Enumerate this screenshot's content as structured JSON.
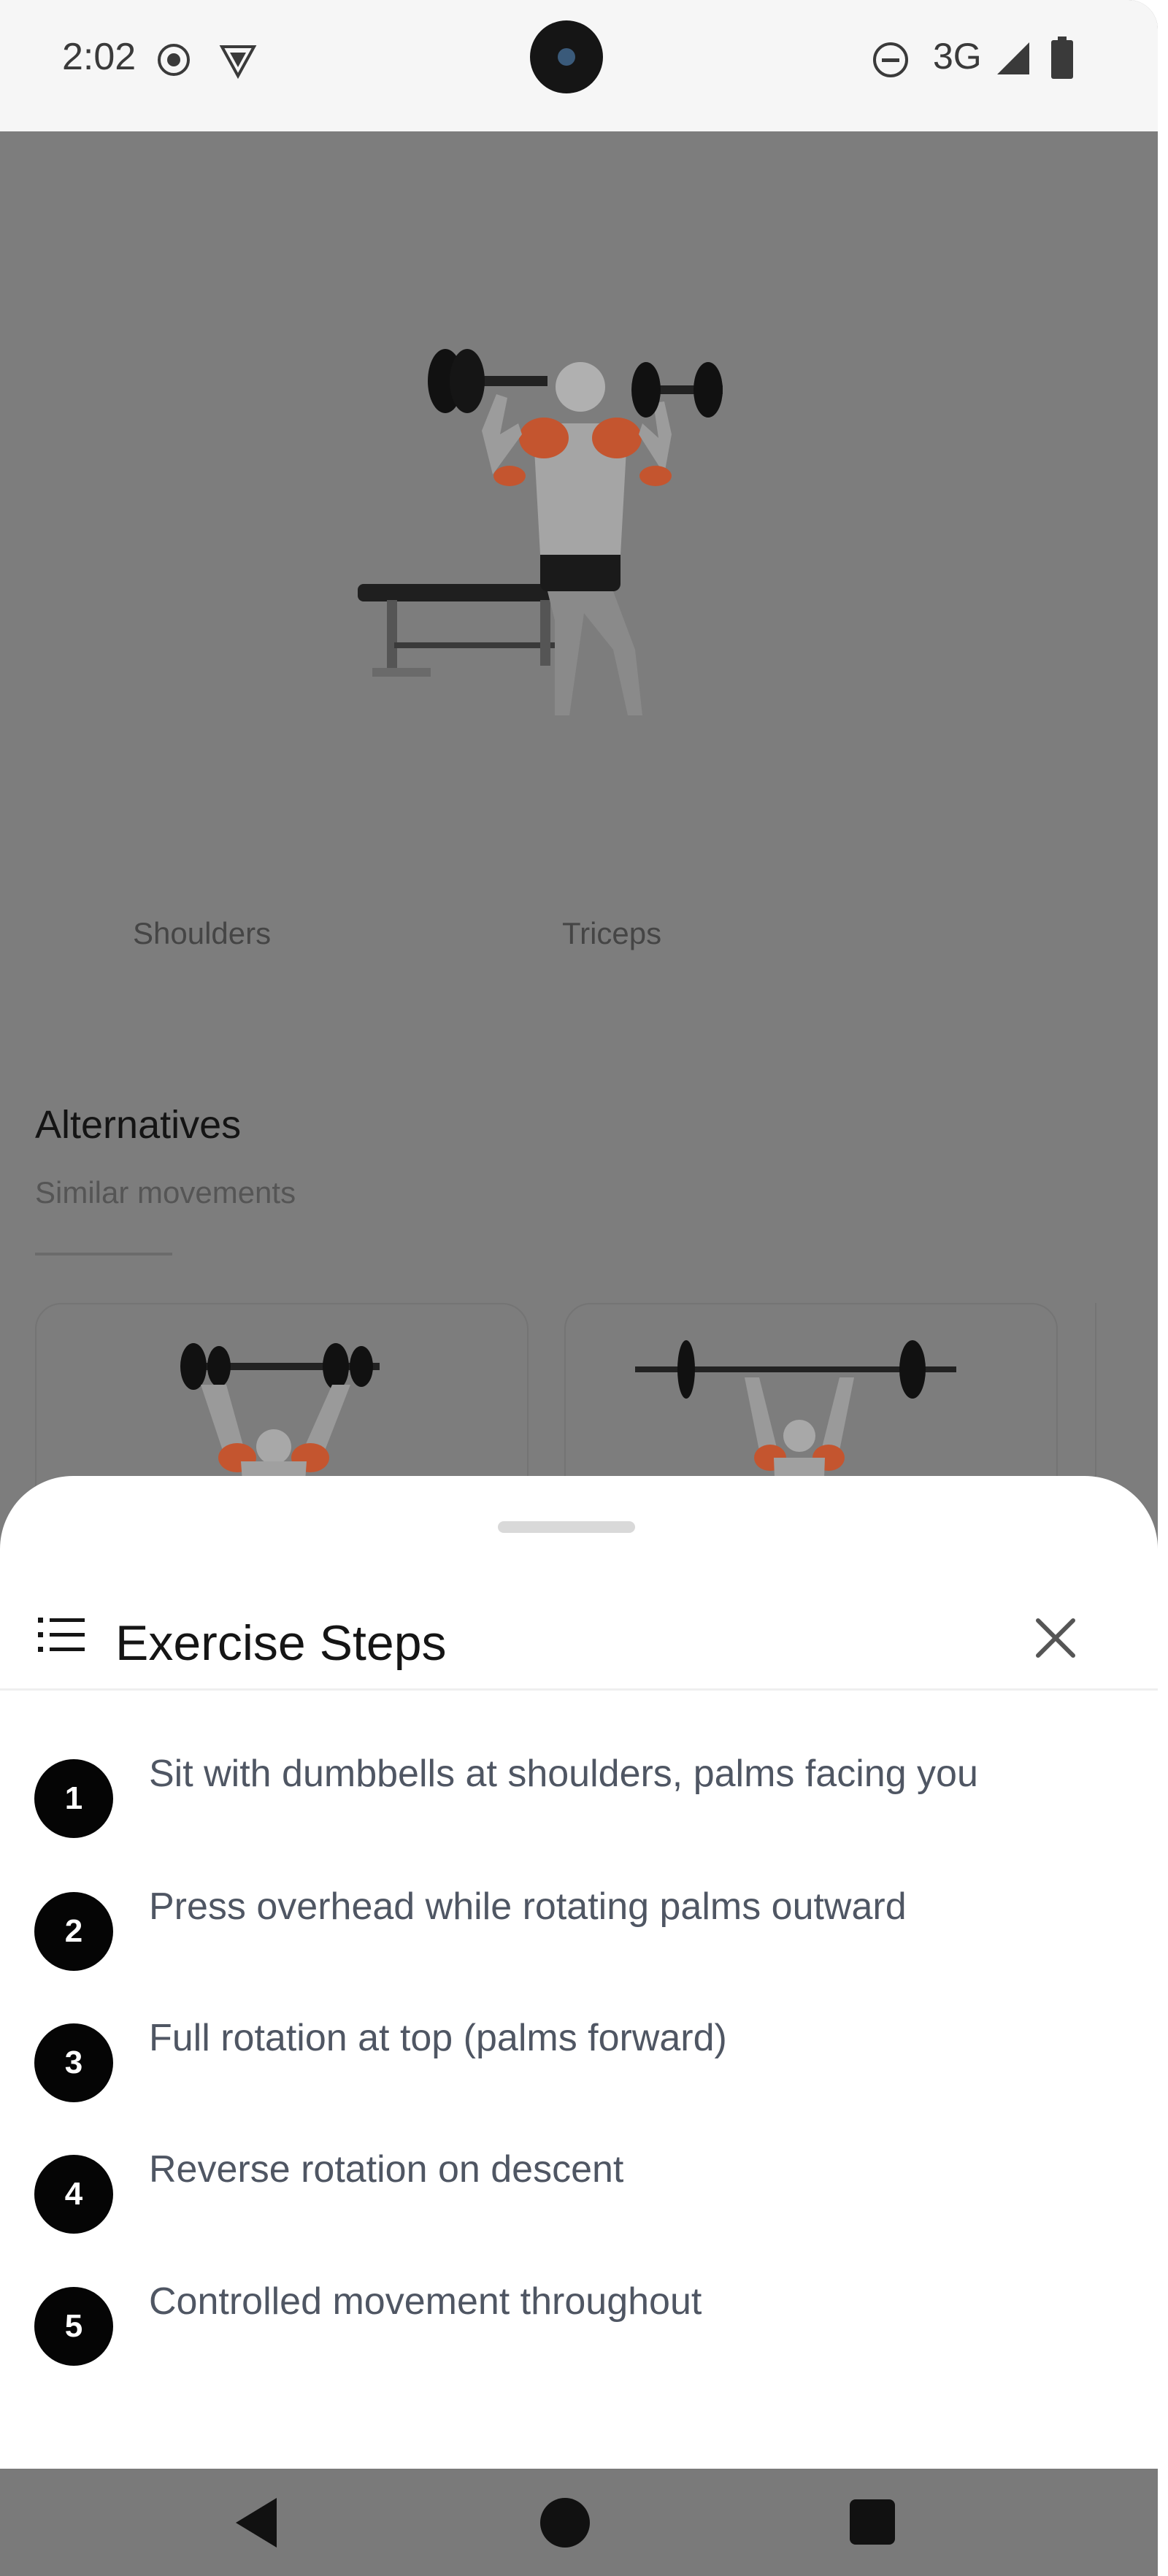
{
  "status_bar": {
    "time": "2:02",
    "network": "3G"
  },
  "background_page": {
    "muscle_labels": [
      "Shoulders",
      "Triceps"
    ],
    "alternatives": {
      "title": "Alternatives",
      "subtitle": "Similar movements"
    }
  },
  "sheet": {
    "title": "Exercise Steps",
    "steps": [
      {
        "number": "1",
        "text": "Sit with dumbbells at shoulders, palms facing you"
      },
      {
        "number": "2",
        "text": "Press overhead while rotating palms outward"
      },
      {
        "number": "3",
        "text": "Full rotation at top (palms forward)"
      },
      {
        "number": "4",
        "text": "Reverse rotation on descent"
      },
      {
        "number": "5",
        "text": "Controlled movement throughout"
      }
    ]
  },
  "colors": {
    "scrim": "#7d7d7d",
    "accent_muscle": "#c4552f",
    "step_badge": "#050505",
    "step_text": "#4f5663"
  }
}
